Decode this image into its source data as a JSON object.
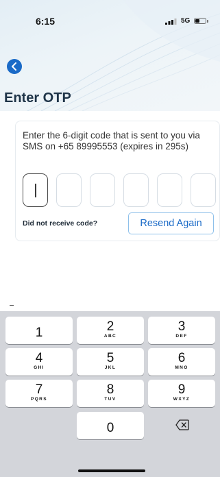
{
  "status_bar": {
    "time": "6:15",
    "network": "5G",
    "icons": [
      "signal-bars-icon",
      "battery-icon"
    ]
  },
  "header": {
    "back_icon": "chevron-left-icon",
    "title": "Enter OTP",
    "accent_color": "#1a6ac7"
  },
  "otp": {
    "instructions": "Enter the 6-digit code that is sent to you via SMS on +65 89995553 (expires in 295s)",
    "digit_count": 6,
    "values": [
      "",
      "",
      "",
      "",
      "",
      ""
    ],
    "active_index": 0
  },
  "resend": {
    "prompt": "Did not receive code?",
    "button_label": "Resend Again"
  },
  "keypad": {
    "keys": [
      {
        "digit": "1",
        "letters": ""
      },
      {
        "digit": "2",
        "letters": "ABC"
      },
      {
        "digit": "3",
        "letters": "DEF"
      },
      {
        "digit": "4",
        "letters": "GHI"
      },
      {
        "digit": "5",
        "letters": "JKL"
      },
      {
        "digit": "6",
        "letters": "MNO"
      },
      {
        "digit": "7",
        "letters": "PQRS"
      },
      {
        "digit": "8",
        "letters": "TUV"
      },
      {
        "digit": "9",
        "letters": "WXYZ"
      },
      {
        "digit": "0",
        "letters": ""
      }
    ],
    "delete_icon": "backspace-icon"
  }
}
